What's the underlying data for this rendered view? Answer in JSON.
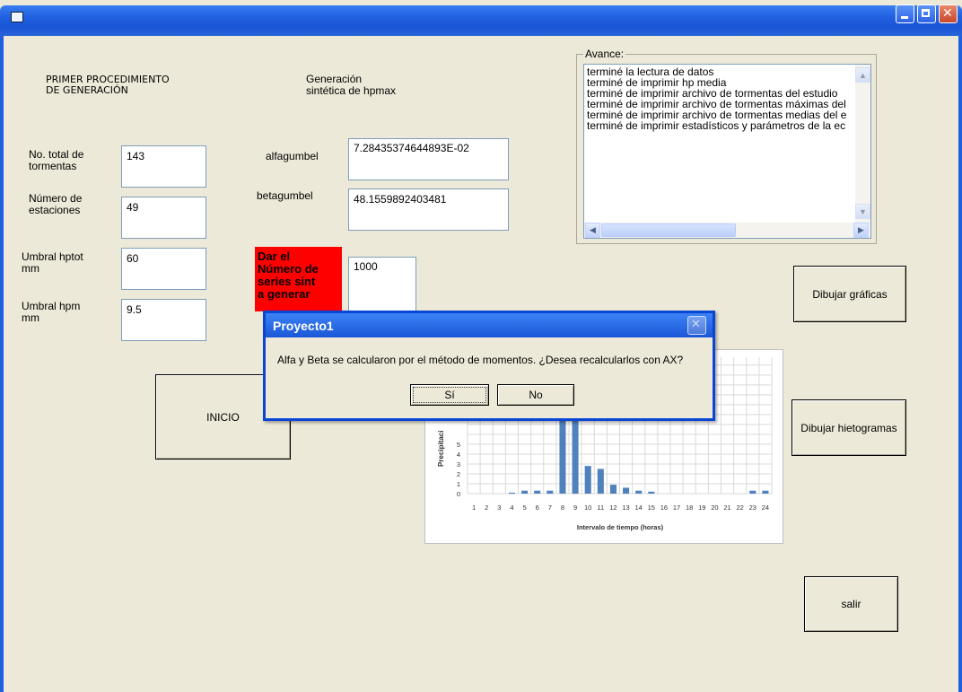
{
  "window": {
    "title": ""
  },
  "labels": {
    "procedure_title": "PRIMER PROCEDIMIENTO\nDE GENERACIÓN",
    "generation_title": "Generación\nsintética de hpmax",
    "total_storms": "No. total de\ntormentas",
    "num_stations": "Número de\nestaciones",
    "umbral_hptot": "Umbral hptot\nmm",
    "umbral_hpm": "Umbral hpm\nmm",
    "alfagumbel": "alfagumbel",
    "betagumbel": "betagumbel",
    "series_prompt": "Dar el\nNúmero de\nseries sint\na generar"
  },
  "fields": {
    "total_storms": "143",
    "num_stations": "49",
    "umbral_hptot": "60",
    "umbral_hpm": "9.5",
    "alfagumbel": "7.28435374644893E-02",
    "betagumbel": "48.1559892403481",
    "num_series": "1000"
  },
  "avance": {
    "legend": "Avance:",
    "items": [
      "terminé la lectura de datos",
      "terminé de imprimir hp media",
      "terminé de imprimir archivo de tormentas del estudio",
      "terminé de imprimir archivo de tormentas máximas del",
      "terminé de imprimir archivo de tormentas medias del e",
      "terminé de imprimir estadísticos y parámetros de la ec"
    ]
  },
  "buttons": {
    "inicio": "INICIO",
    "dibujar_graficas": "Dibujar gráficas",
    "dibujar_hietogramas": "Dibujar hietogramas",
    "salir": "salir"
  },
  "chart_data": {
    "type": "bar",
    "title": "",
    "xlabel": "Intervalo de tiempo (horas)",
    "ylabel": "Precipitaci",
    "categories": [
      "1",
      "2",
      "3",
      "4",
      "5",
      "6",
      "7",
      "8",
      "9",
      "10",
      "11",
      "12",
      "13",
      "14",
      "15",
      "16",
      "17",
      "18",
      "19",
      "20",
      "21",
      "22",
      "23",
      "24"
    ],
    "values": [
      0,
      0,
      0,
      0.1,
      0.3,
      0.3,
      0.3,
      9,
      9,
      2.8,
      2.5,
      0.9,
      0.6,
      0.3,
      0.2,
      0,
      0,
      0,
      0,
      0,
      0,
      0,
      0.3,
      0.3
    ],
    "yticks": [
      "0",
      "1",
      "2",
      "3",
      "4",
      "5"
    ],
    "ylim": [
      0,
      6
    ],
    "grid": true,
    "color": "#4f81bd"
  },
  "dialog": {
    "title": "Proyecto1",
    "message": "Alfa y Beta se calcularon por el método de momentos. ¿Desea recalcularlos con AX?",
    "yes": "Sí",
    "no": "No"
  }
}
